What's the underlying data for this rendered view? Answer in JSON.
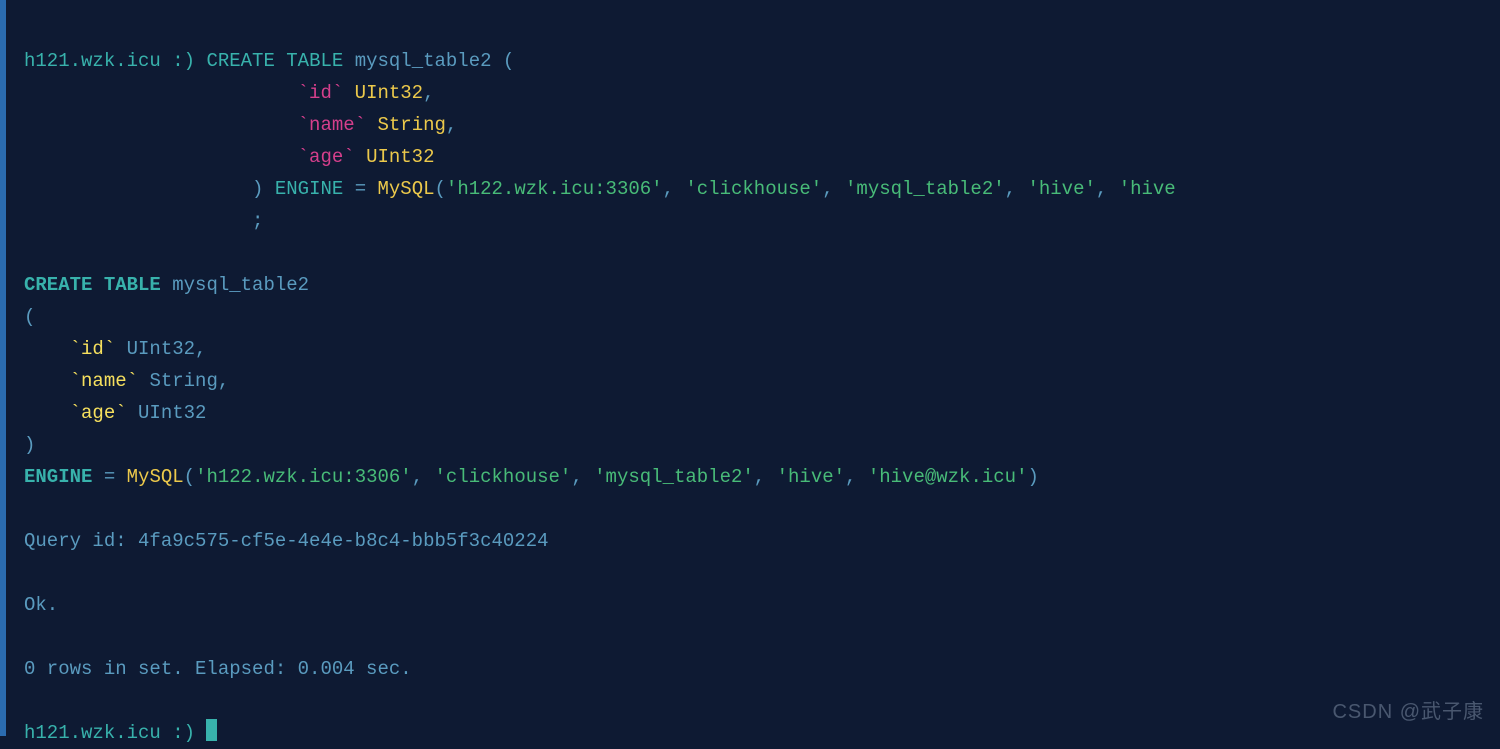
{
  "prompt": {
    "host": "h121.wzk.icu :)",
    "indent": "                    "
  },
  "cmd": {
    "create": "CREATE",
    "table_kw": "TABLE",
    "table_name": "mysql_table2",
    "lp": "(",
    "rp": ")",
    "comma": ",",
    "col_id_bt": "`id`",
    "col_id_ty": "UInt32",
    "col_name_bt": "`name`",
    "col_name_ty": "String",
    "col_age_bt": "`age`",
    "col_age_ty": "UInt32",
    "engine_kw": "ENGINE",
    "eq": "=",
    "mysql_fn": "MySQL",
    "arg1": "'h122.wzk.icu:3306'",
    "arg2": "'clickhouse'",
    "arg3": "'mysql_table2'",
    "arg4": "'hive'",
    "arg5_trunc": "'hive",
    "semi": ";"
  },
  "echo": {
    "create": "CREATE TABLE",
    "tbl": "mysql_table2",
    "lp": "(",
    "rp": ")",
    "id_bt": "`id`",
    "id_ty": "UInt32",
    "name_bt": "`name`",
    "name_ty": "String",
    "age_bt": "`age`",
    "age_ty": "UInt32",
    "engine": "ENGINE",
    "eq": "=",
    "mysql_fn": "MySQL",
    "a1": "'h122.wzk.icu:3306'",
    "a2": "'clickhouse'",
    "a3": "'mysql_table2'",
    "a4": "'hive'",
    "a5": "'hive@wzk.icu'"
  },
  "result": {
    "query_id_label": "Query id:",
    "query_id": "4fa9c575-cf5e-4e4e-b8c4-bbb5f3c40224",
    "ok": "Ok.",
    "rows": "0 rows in set. Elapsed: 0.004 sec."
  },
  "watermark": "CSDN @武子康"
}
